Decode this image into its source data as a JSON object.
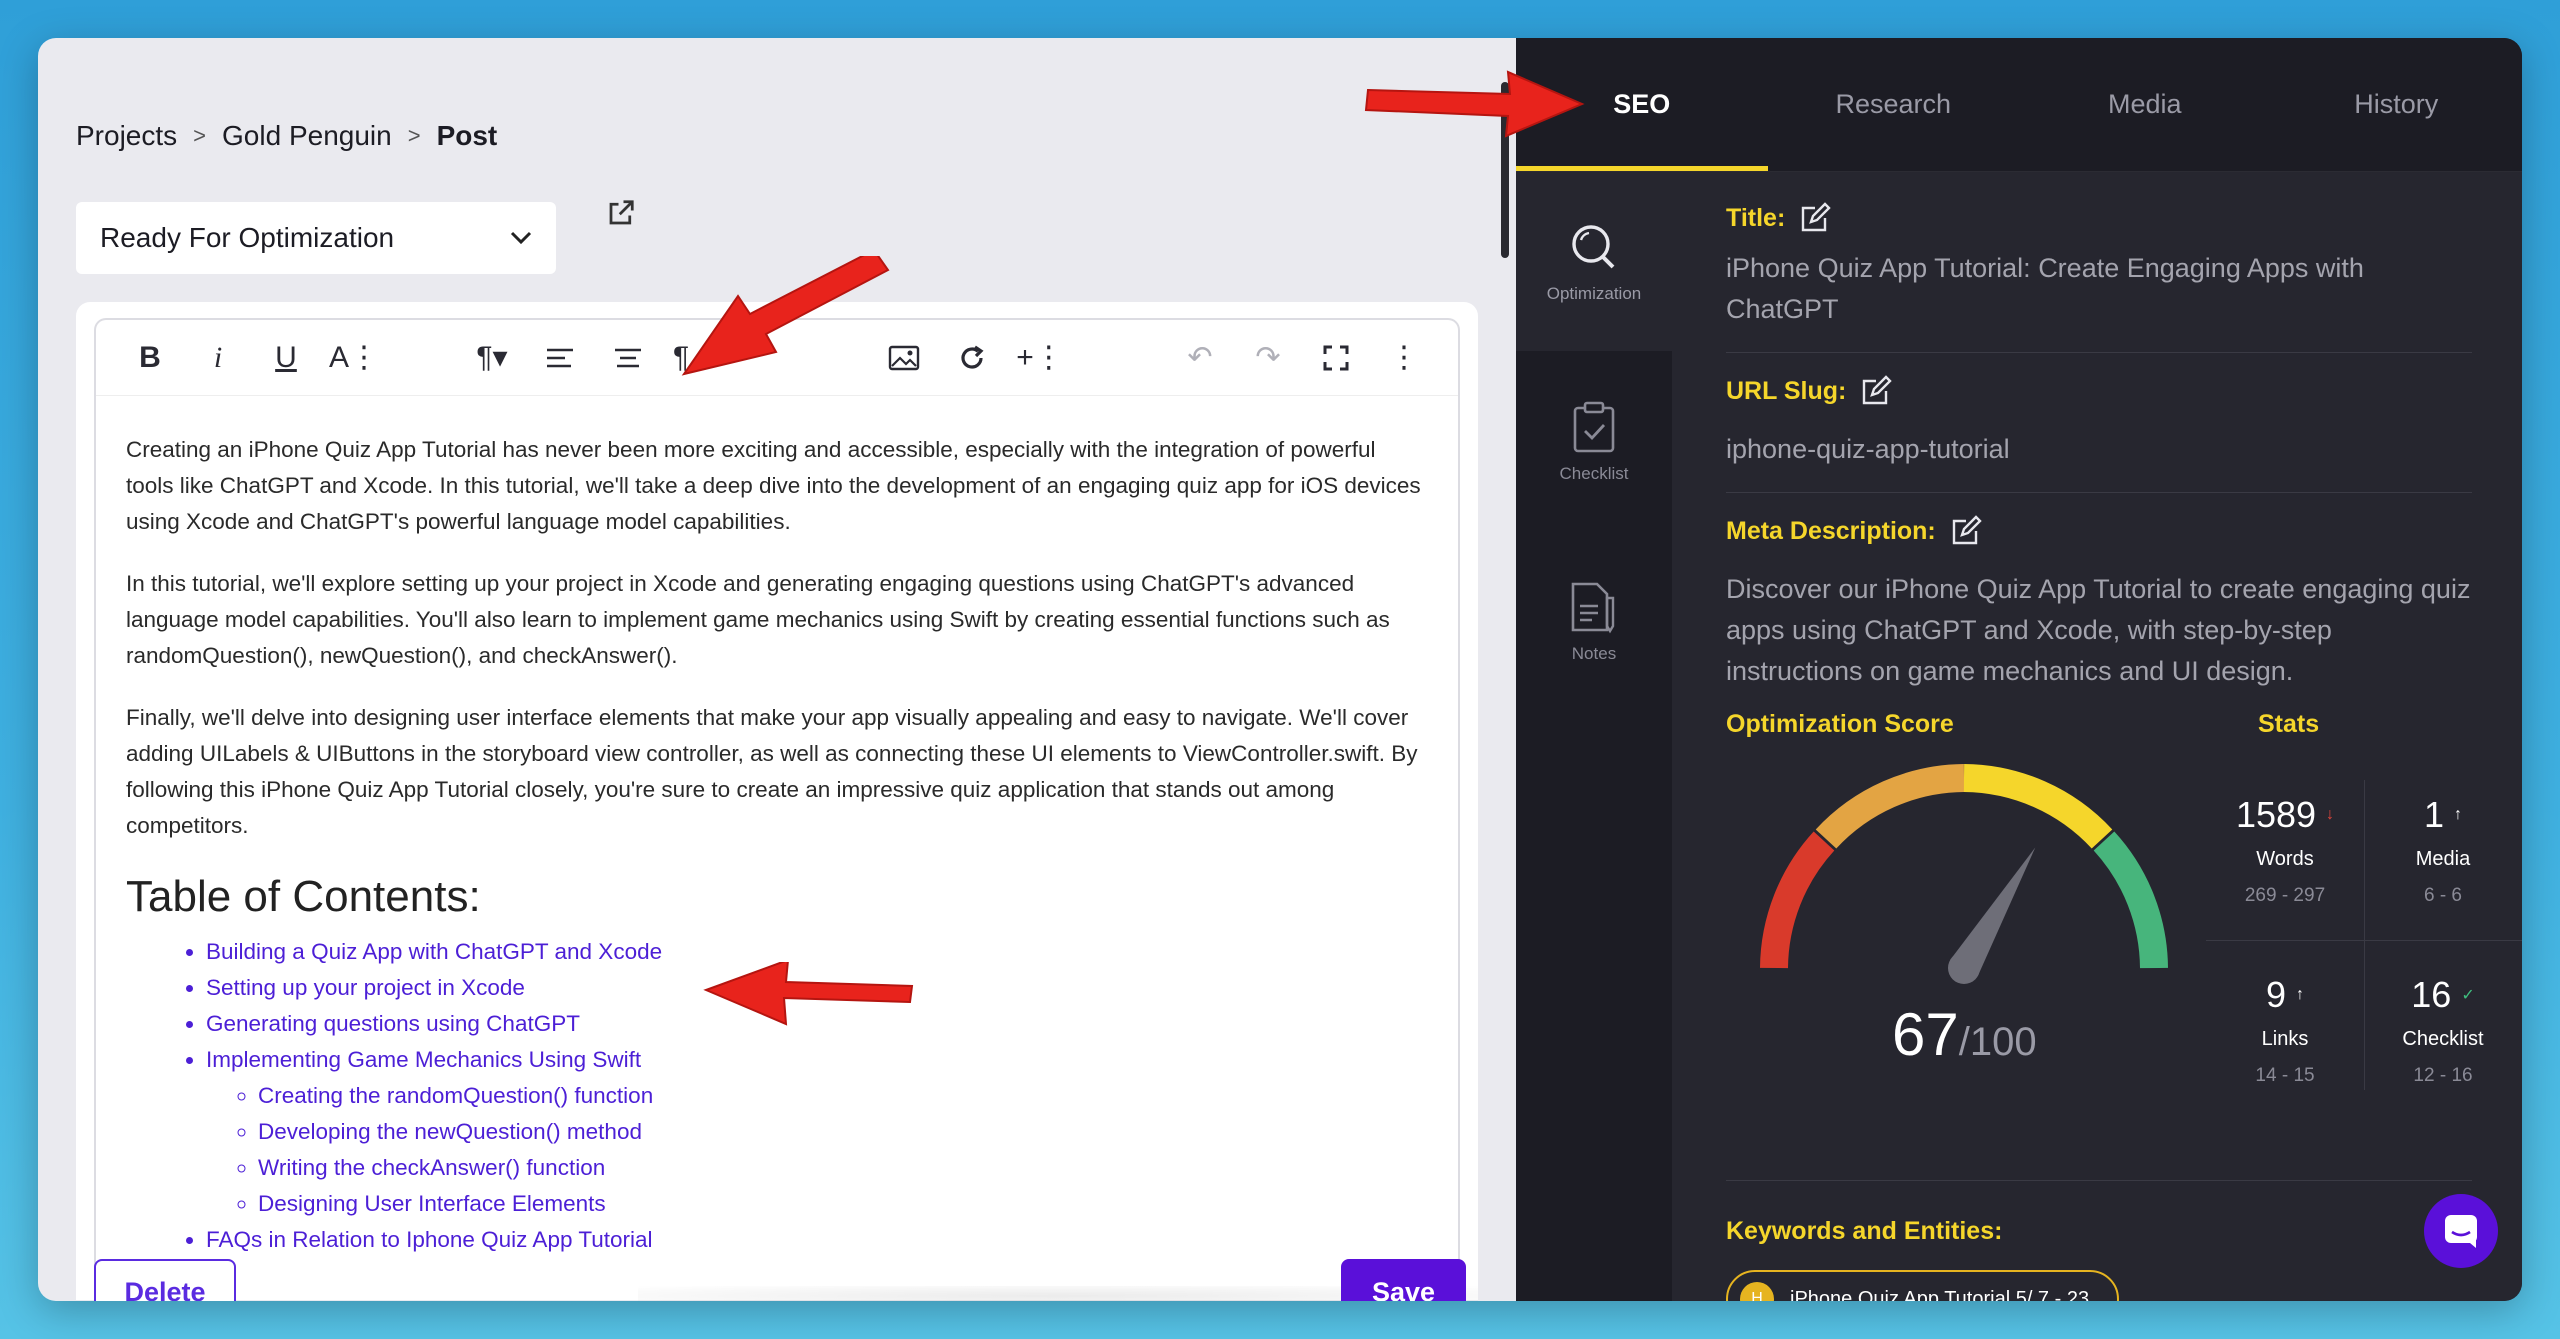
{
  "breadcrumb": {
    "items": [
      "Projects",
      "Gold Penguin",
      "Post"
    ],
    "separator": ">"
  },
  "status_select": {
    "value": "Ready For Optimization"
  },
  "toolbar": {
    "buttons": [
      "bold-icon",
      "italic-icon",
      "underline-icon",
      "font-size-icon",
      "paragraph-icon",
      "align-left-icon",
      "align-center-icon",
      "paragraph-format-icon",
      "image-icon",
      "redo-circle-icon",
      "insert-more-icon",
      "undo-icon",
      "redo-icon",
      "fullscreen-icon",
      "more-icon"
    ]
  },
  "content": {
    "p1": "Creating an iPhone Quiz App Tutorial has never been more exciting and accessible, especially with the integration of powerful tools like ChatGPT and Xcode. In this tutorial, we'll take a deep dive into the development of an engaging quiz app for iOS devices using Xcode and ChatGPT's powerful language model capabilities.",
    "p2": "In this tutorial, we'll explore setting up your project in Xcode and generating engaging questions using ChatGPT's advanced language model capabilities. You'll also learn to implement game mechanics using Swift by creating essential functions such as randomQuestion(), newQuestion(), and checkAnswer().",
    "p3": "Finally, we'll delve into designing user interface elements that make your app visually appealing and easy to navigate. We'll cover adding UILabels & UIButtons in the storyboard view controller, as well as connecting these UI elements to ViewController.swift. By following this iPhone Quiz App Tutorial closely, you're sure to create an impressive quiz application that stands out among competitors.",
    "toc_heading": "Table of Contents:",
    "toc": [
      "Building a Quiz App with ChatGPT and Xcode",
      "Setting up your project in Xcode",
      "Generating questions using ChatGPT",
      "Implementing Game Mechanics Using Swift"
    ],
    "toc_sub": [
      "Creating the randomQuestion() function",
      "Developing the newQuestion() method",
      "Writing the checkAnswer() function",
      "Designing User Interface Elements"
    ],
    "toc_last": "FAQs in Relation to Iphone Quiz App Tutorial"
  },
  "actions": {
    "delete": "Delete",
    "save": "Save"
  },
  "tabs": [
    "SEO",
    "Research",
    "Media",
    "History"
  ],
  "active_tab": "SEO",
  "side_nav": [
    "Optimization",
    "Checklist",
    "Notes"
  ],
  "seo": {
    "title_label": "Title:",
    "title_value": "iPhone Quiz App Tutorial: Create Engaging Apps with ChatGPT",
    "slug_label": "URL Slug:",
    "slug_value": "iphone-quiz-app-tutorial",
    "meta_label": "Meta Description:",
    "meta_value": "Discover our iPhone Quiz App Tutorial to create engaging quiz apps using ChatGPT and Xcode, with step-by-step instructions on game mechanics and UI design.",
    "score_label": "Optimization Score",
    "stats_label": "Stats",
    "score": "67",
    "score_max": "/100",
    "score_fraction": 0.67,
    "stats": [
      {
        "value": "1589",
        "indicator": "↓",
        "label": "Words",
        "range": "269 - 297",
        "color": "#e0443a"
      },
      {
        "value": "1",
        "indicator": "↑",
        "label": "Media",
        "range": "6 - 6",
        "color": "#ffffff"
      },
      {
        "value": "9",
        "indicator": "↑",
        "label": "Links",
        "range": "14 - 15",
        "color": "#ffffff"
      },
      {
        "value": "16",
        "indicator": "✓",
        "label": "Checklist",
        "range": "12 - 16",
        "color": "#3fbf7f"
      }
    ],
    "keywords_label": "Keywords and Entities:",
    "keyword_chip": {
      "initial": "H",
      "text": "iPhone Quiz App Tutorial 5/ 7 - 23"
    }
  },
  "colors": {
    "accent_yellow": "#f5d62b",
    "purple": "#5a10d9",
    "dark_bg": "#1c1c24",
    "panel_bg": "#26262f",
    "arrow_red": "#e8231c"
  }
}
